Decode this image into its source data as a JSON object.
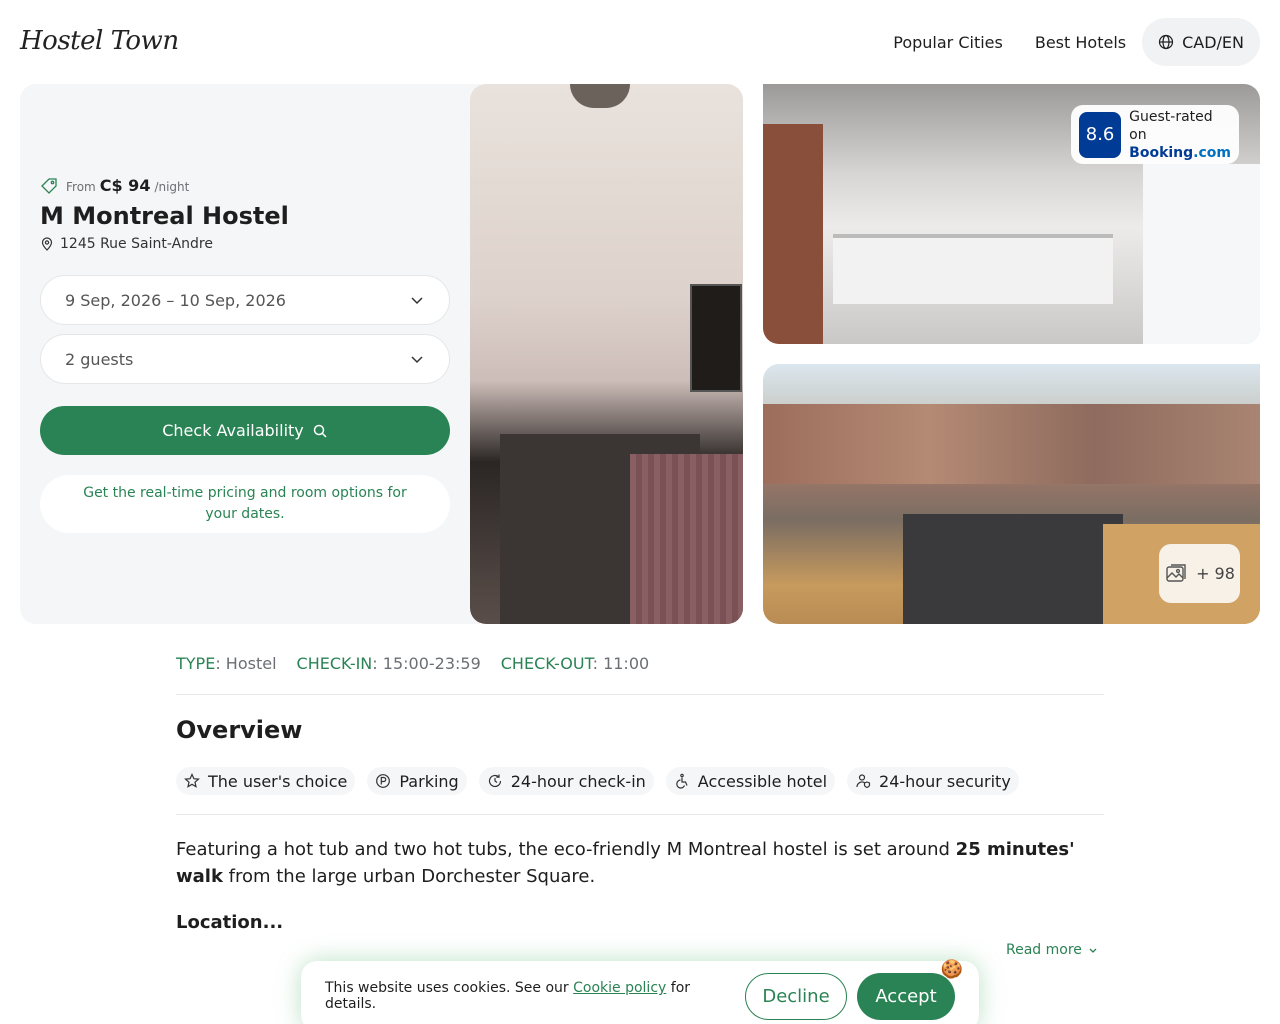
{
  "header": {
    "logo": "Hostel Town",
    "nav": [
      {
        "label": "Popular Cities"
      },
      {
        "label": "Best Hotels"
      }
    ],
    "lang": "CAD/EN"
  },
  "booking": {
    "price_from": "From",
    "price_amount": "C$ 94",
    "price_unit": "/night",
    "name": "M Montreal Hostel",
    "address": "1245 Rue Saint-Andre",
    "dates": "9 Sep, 2026 – 10 Sep, 2026",
    "guests": "2 guests",
    "check_button": "Check Availability",
    "note": "Get the real-time pricing and room options for your dates."
  },
  "gallery": {
    "rating_score": "8.6",
    "rating_label": "Guest-rated on",
    "rating_brand": "Booking",
    "rating_brand_suffix": ".com",
    "more_count": "+ 98"
  },
  "info": {
    "type_key": "TYPE",
    "type_val": ": Hostel",
    "checkin_key": "CHECK-IN",
    "checkin_val": ": 15:00-23:59",
    "checkout_key": "CHECK-OUT",
    "checkout_val": ": 11:00"
  },
  "overview": {
    "title": "Overview",
    "chips": [
      {
        "label": "The user's choice",
        "icon": "star-icon"
      },
      {
        "label": "Parking",
        "icon": "parking-icon"
      },
      {
        "label": "24-hour check-in",
        "icon": "clock-cycle-icon"
      },
      {
        "label": "Accessible hotel",
        "icon": "wheelchair-icon"
      },
      {
        "label": "24-hour security",
        "icon": "guard-icon"
      }
    ],
    "desc_part1": "Featuring a hot tub and two hot tubs, the eco-friendly M Montreal hostel is set around ",
    "desc_bold": "25 minutes' walk",
    "desc_part2": " from the large urban Dorchester Square.",
    "location_heading": "Location...",
    "read_more": "Read more"
  },
  "cookie": {
    "text_before": "This website uses cookies. See our ",
    "link": "Cookie policy",
    "text_after": " for details.",
    "decline": "Decline",
    "accept": "Accept"
  },
  "colors": {
    "accent": "#2a8354",
    "booking_blue": "#003b95",
    "panel_bg": "#f5f6f7"
  }
}
